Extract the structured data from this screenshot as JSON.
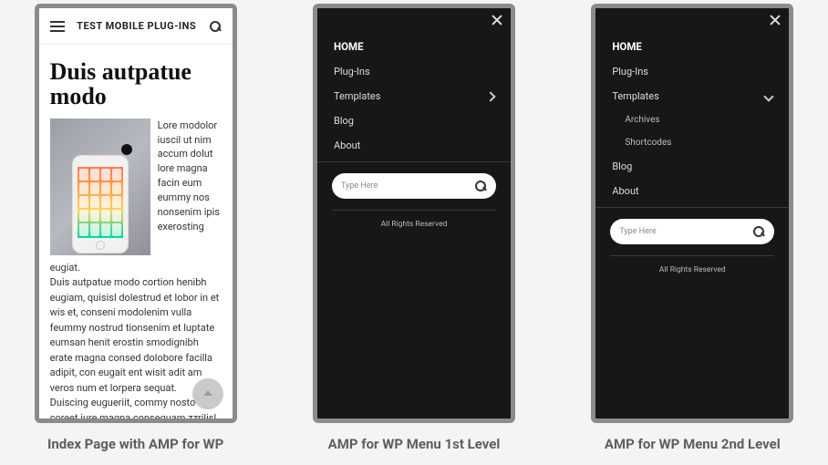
{
  "panel1": {
    "site_title": "TEST MOBILE PLUG-INS",
    "post_title": "Duis autpatue modo",
    "lead": "Lore modolor iuscil ut nim accum dolut lore magna facin eum eummy nos nonsenim ipis exerosting",
    "lead_tail": "eugiat.",
    "body1": "Duis autpatue modo cortion henibh eugiam, quisisl dolestrud et lobor in et wis et, conseni modolenim vulla feummy nostrud tionsenim et luptate eumsan henit erostin smodignibh erate magna consed dolobore facilla adipit, con eugait ent wisit adit am veros num et lorpera sequat.",
    "body2": "Duiscing eugueriit, commy nosto coreet iure magna consequam zzrilisl lustrud magna"
  },
  "menu": {
    "home": "HOME",
    "plugins": "Plug-Ins",
    "templates": "Templates",
    "blog": "Blog",
    "about": "About",
    "sub_archives": "Archives",
    "sub_shortcodes": "Shortcodes",
    "search_placeholder": "Type Here",
    "footer": "All Rights Reserved"
  },
  "captions": {
    "p1": "Index Page with AMP for WP",
    "p2": "AMP for WP Menu 1st Level",
    "p3": "AMP for WP Menu 2nd Level"
  }
}
